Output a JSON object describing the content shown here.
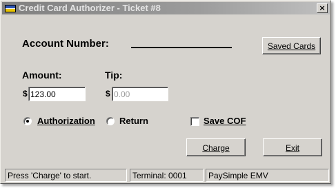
{
  "window": {
    "title": "Credit Card Authorizer - Ticket #8",
    "close_glyph": "×"
  },
  "account": {
    "label": "Account Number:",
    "saved_cards_button": "Saved Cards"
  },
  "amount": {
    "label": "Amount:",
    "currency": "$",
    "value": "123.00"
  },
  "tip": {
    "label": "Tip:",
    "currency": "$",
    "placeholder": "0.00"
  },
  "transaction_type": {
    "options": [
      {
        "label": "Authorization",
        "selected": true
      },
      {
        "label": "Return",
        "selected": false
      }
    ]
  },
  "save_cof": {
    "label": "Save COF",
    "checked": false
  },
  "actions": {
    "charge_label": "Charge",
    "exit_label": "Exit"
  },
  "status": {
    "message": "Press 'Charge' to start.",
    "terminal": "Terminal: 0001",
    "provider": "PaySimple EMV"
  },
  "colors": {
    "title_gradient_start": "#808080",
    "title_gradient_end": "#c0c0c0",
    "face": "#d6d3ce"
  },
  "icons": [
    "app-icon",
    "close-icon",
    "radio-selected-icon",
    "radio-unselected-icon",
    "checkbox-icon"
  ]
}
